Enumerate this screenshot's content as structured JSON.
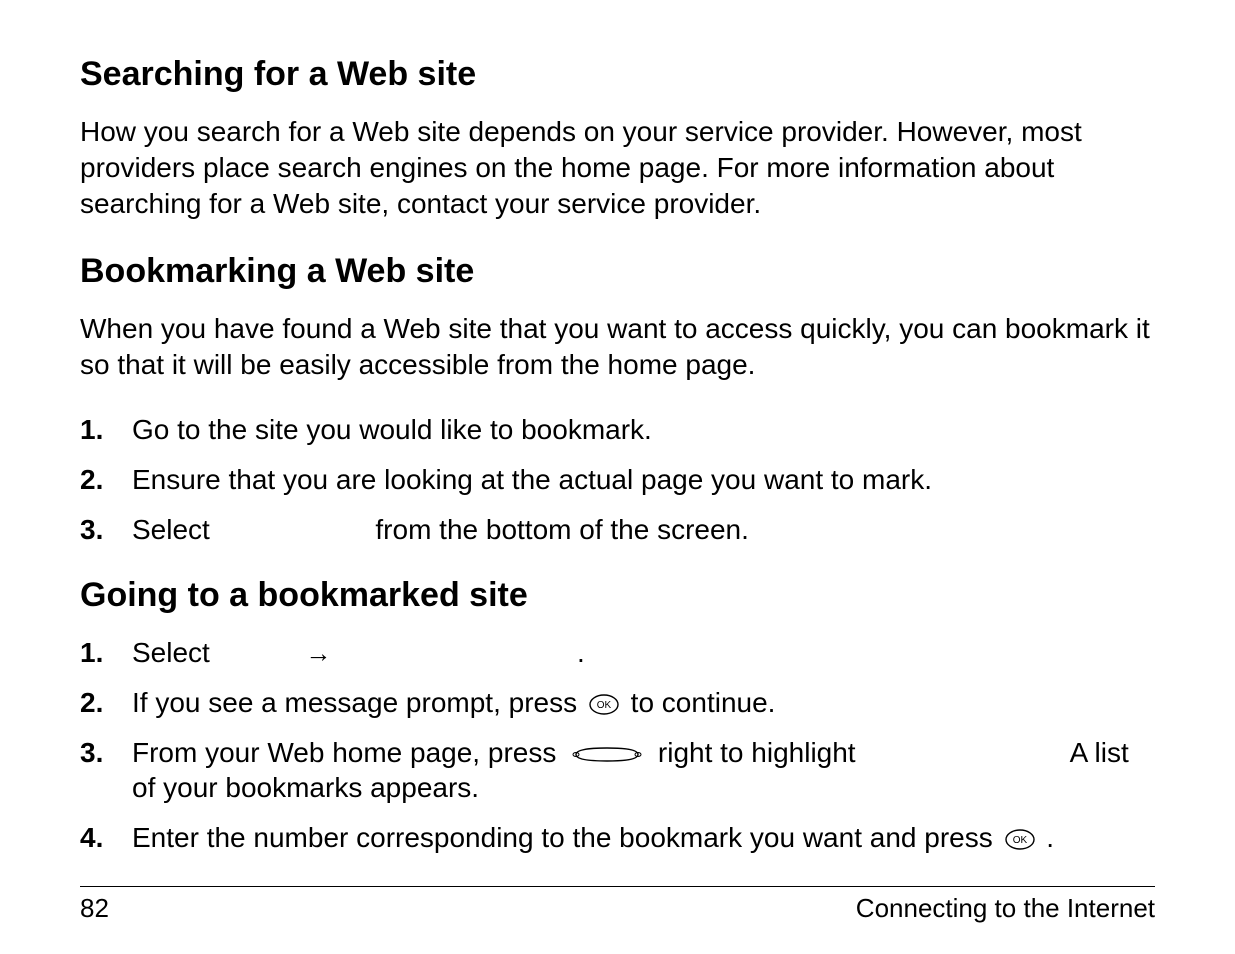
{
  "section1": {
    "heading": "Searching for a Web site",
    "body": "How you search for a Web site depends on your service provider. However, most providers place search engines on the home page. For more information about searching for a Web site, contact your service provider."
  },
  "section2": {
    "heading": "Bookmarking a Web site",
    "intro": "When you have found a Web site that you want to access quickly, you can bookmark it so that it will be easily accessible from the home page.",
    "steps": {
      "n1": "1.",
      "n2": "2.",
      "n3": "3.",
      "s1": "Go to the site you would like to bookmark.",
      "s2": "Ensure that you are looking at the actual page you want to mark.",
      "s3a": "Select ",
      "s3b": " from the bottom of the screen."
    }
  },
  "section3": {
    "heading": "Going to a bookmarked site",
    "steps": {
      "n1": "1.",
      "n2": "2.",
      "n3": "3.",
      "n4": "4.",
      "s1a": "Select ",
      "s1arrow": "→",
      "s1period": ".",
      "s2a": "If you see a message prompt, press ",
      "s2b": " to continue.",
      "s3a": "From your Web home page, press ",
      "s3b": " right to highlight ",
      "s3c": " A list of your bookmarks appears.",
      "s4a": "Enter the number corresponding to the bookmark you want and press ",
      "s4b": "."
    }
  },
  "footer": {
    "page_number": "82",
    "chapter": "Connecting to the Internet"
  }
}
